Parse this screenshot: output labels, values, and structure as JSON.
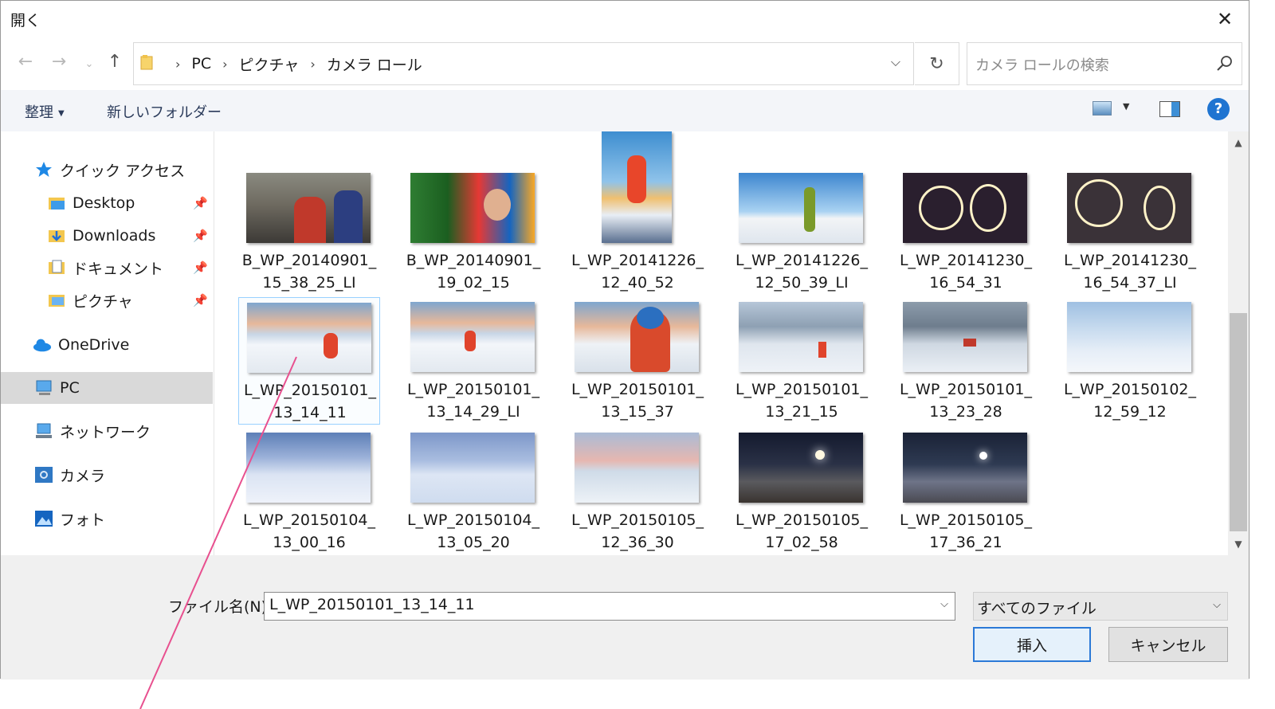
{
  "window": {
    "title": "開く"
  },
  "address": {
    "crumbs": [
      "PC",
      "ピクチャ",
      "カメラ ロール"
    ]
  },
  "search": {
    "placeholder": "カメラ ロールの検索"
  },
  "toolbar": {
    "organize": "整理",
    "new_folder": "新しいフォルダー",
    "help": "?"
  },
  "nav": {
    "quick_access": "クイック アクセス",
    "desktop": "Desktop",
    "downloads": "Downloads",
    "documents": "ドキュメント",
    "pictures": "ピクチャ",
    "onedrive": "OneDrive",
    "pc": "PC",
    "network": "ネットワーク",
    "camera": "カメラ",
    "photos": "フォト"
  },
  "files": [
    {
      "line1": "B_WP_20140901_",
      "line2": "15_38_25_LI"
    },
    {
      "line1": "B_WP_20140901_",
      "line2": "19_02_15"
    },
    {
      "line1": "L_WP_20141226_",
      "line2": "12_40_52"
    },
    {
      "line1": "L_WP_20141226_",
      "line2": "12_50_39_LI"
    },
    {
      "line1": "L_WP_20141230_",
      "line2": "16_54_31"
    },
    {
      "line1": "L_WP_20141230_",
      "line2": "16_54_37_LI"
    },
    {
      "line1": "L_WP_20150101_",
      "line2": "13_14_11"
    },
    {
      "line1": "L_WP_20150101_",
      "line2": "13_14_29_LI"
    },
    {
      "line1": "L_WP_20150101_",
      "line2": "13_15_37"
    },
    {
      "line1": "L_WP_20150101_",
      "line2": "13_21_15"
    },
    {
      "line1": "L_WP_20150101_",
      "line2": "13_23_28"
    },
    {
      "line1": "L_WP_20150102_",
      "line2": "12_59_12"
    },
    {
      "line1": "L_WP_20150104_",
      "line2": "13_00_16"
    },
    {
      "line1": "L_WP_20150104_",
      "line2": "13_05_20"
    },
    {
      "line1": "L_WP_20150105_",
      "line2": "12_36_30"
    },
    {
      "line1": "L_WP_20150105_",
      "line2": "17_02_58"
    },
    {
      "line1": "L_WP_20150105_",
      "line2": "17_36_21"
    }
  ],
  "footer": {
    "filename_label": "ファイル名(N):",
    "filename_value": "L_WP_20150101_13_14_11",
    "filetype": "すべてのファイル",
    "insert": "挿入",
    "cancel": "キャンセル"
  },
  "colors": {
    "accent": "#2b79d7",
    "selection": "#99d1ff",
    "annotation": "#e8508f"
  }
}
